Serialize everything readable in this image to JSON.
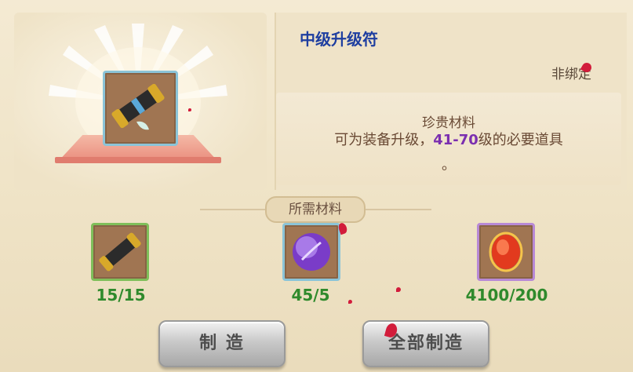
{
  "item": {
    "name": "中级升级符",
    "bind_status": "非绑定",
    "category": "珍贵材料",
    "description_prefix": "可为装备升级，",
    "level_range": "41-70",
    "description_suffix": "级的必要道具",
    "description_tail": "。"
  },
  "materials_section": {
    "title": "所需材料",
    "items": [
      {
        "icon": "scroll-icon",
        "count": "15/15",
        "frame_color": "#7fbf5a"
      },
      {
        "icon": "purple-orb-icon",
        "count": "45/5",
        "frame_color": "#8bc4d8"
      },
      {
        "icon": "red-gem-icon",
        "count": "4100/200",
        "frame_color": "#b889d6"
      }
    ]
  },
  "buttons": {
    "craft": "制 造",
    "craft_all": "全部制造"
  },
  "colors": {
    "title": "#1e3ea0",
    "level_highlight": "#7b2fb0",
    "count_green": "#2f8a2c"
  }
}
